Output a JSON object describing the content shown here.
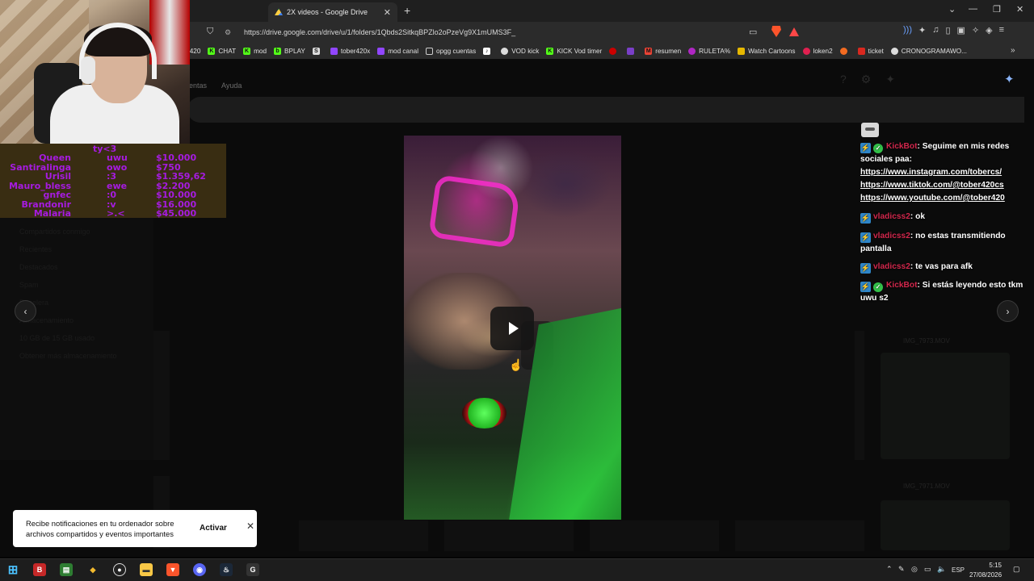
{
  "browser": {
    "tab_title": "2X videos - Google Drive",
    "url": "https://drive.google.com/drive/u/1/folders/1Qbds2SitkqBPZlo2oPzeVg9X1mUMS3F_",
    "bookmarks": [
      "r420",
      "CHAT",
      "mod",
      "BPLAY",
      "",
      "tober420x",
      "mod canal",
      "opgg cuentas",
      "",
      "VOD kick",
      "KICK Vod timer",
      "",
      "",
      "resumen",
      "RULETA%",
      "Watch Cartoons",
      "loken2",
      "",
      "ticket",
      "CRONOGRAMAWO..."
    ]
  },
  "drive": {
    "menu_partial": "ientas",
    "menu_help": "Ayuda",
    "sidebar_items": [
      "Compartidos conmigo",
      "Recientes",
      "Destacados",
      "Spam",
      "Papelera",
      "Almacenamiento",
      "10 GB de 15 GB usado",
      "Obtener más almacenamiento"
    ],
    "file_labels": [
      "IMG_7973.MOV",
      "IMG_7971.MOV"
    ]
  },
  "leaderboard": {
    "header": "ty<3",
    "rows": [
      {
        "name": "Queen",
        "emote": "uwu",
        "value": "$10.000"
      },
      {
        "name": "Santiralinga",
        "emote": "owo",
        "value": "$750"
      },
      {
        "name": "Urisil",
        "emote": ":3",
        "value": "$1.359,62"
      },
      {
        "name": "Mauro_bless",
        "emote": "ewe",
        "value": "$2.200"
      },
      {
        "name": "gnfec",
        "emote": ":0",
        "value": "$10.000"
      },
      {
        "name": "Brandonir",
        "emote": ":v",
        "value": "$16.000"
      },
      {
        "name": "Malaria",
        "emote": ">.<",
        "value": "$45.000"
      }
    ]
  },
  "chat": {
    "messages": [
      {
        "user": "KickBot",
        "verified": true,
        "text": "Seguime en mis redes sociales paa:",
        "links": [
          "https://www.instagram.com/tobercs/",
          "https://www.tiktok.com/@tober420cs",
          "https://www.youtube.com/@tober420"
        ]
      },
      {
        "user": "vladicss2",
        "verified": false,
        "text": "ok",
        "links": []
      },
      {
        "user": "vladicss2",
        "verified": false,
        "text": "no estas transmitiendo pantalla",
        "links": []
      },
      {
        "user": "vladicss2",
        "verified": false,
        "text": "te vas para afk",
        "links": []
      },
      {
        "user": "KickBot",
        "verified": true,
        "text": "Si estás leyendo esto tkm uwu s2",
        "links": []
      }
    ]
  },
  "toast": {
    "text": "Recibe notificaciones en tu ordenador sobre archivos compartidos y eventos importantes",
    "action": "Activar"
  },
  "taskbar": {
    "language": "ESP",
    "time": "5:15",
    "date": "27/08/2026"
  },
  "colors": {
    "leaderboard_text": "#a61be0",
    "chat_username": "#d1274c",
    "kick_badge": "#2f86c8"
  }
}
